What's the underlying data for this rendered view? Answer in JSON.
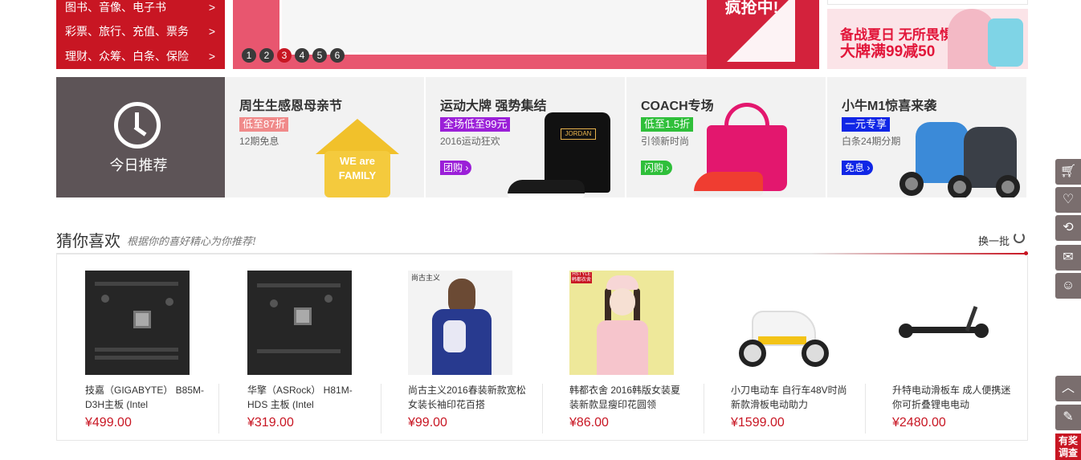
{
  "category_menu": {
    "items": [
      {
        "label": "图书、音像、电子书",
        "arrow": ">"
      },
      {
        "label": "彩票、旅行、充值、票务",
        "arrow": ">"
      },
      {
        "label": "理财、众筹、白条、保险",
        "arrow": ">"
      }
    ]
  },
  "banner": {
    "promo_text": "疯抢中!",
    "dots": [
      "1",
      "2",
      "3",
      "4",
      "5",
      "6"
    ],
    "active_dot": "3"
  },
  "right_ad": {
    "line1": "备战夏日 无所畏惧",
    "line2": "大牌满99减50"
  },
  "today": {
    "label": "今日推荐"
  },
  "recommendations": [
    {
      "title": "周生生感恩母亲节",
      "tag": "低至87折",
      "tag_color": "#f08a8a",
      "subtitle": "12期免息",
      "button": "",
      "image_text": "WE are FAMILY"
    },
    {
      "title": "运动大牌 强势集结",
      "tag": "全场低至99元",
      "tag_color": "#9b1fd8",
      "subtitle": "2016运动狂欢",
      "button": "团购 ›",
      "button_color": "#9b1fd8",
      "image_text": "JORDAN"
    },
    {
      "title": "COACH专场",
      "tag": "低至1.5折",
      "tag_color": "#2fbf3a",
      "subtitle": "引领新时尚",
      "button": "闪购 ›",
      "button_color": "#2fbf3a",
      "image_text": ""
    },
    {
      "title": "小牛M1惊喜来袭",
      "tag": "一元专享",
      "tag_color": "#1026e6",
      "subtitle": "白条24期分期",
      "button": "免息 ›",
      "button_color": "#1026e6",
      "image_text": ""
    }
  ],
  "guess": {
    "title": "猜你喜欢",
    "subtitle": "根据你的喜好精心为你推荐!",
    "refresh": "换一批",
    "products": [
      {
        "name": "技嘉（GIGABYTE） B85M-D3H主板 (Intel",
        "price": "¥499.00"
      },
      {
        "name": "华擎（ASRock） H81M-HDS 主板 (Intel",
        "price": "¥319.00"
      },
      {
        "name": "尚古主义2016春装新款宽松女装长袖印花百搭",
        "price": "¥99.00"
      },
      {
        "name": "韩都衣舍 2016韩版女装夏装新款显瘦印花圆领",
        "price": "¥86.00"
      },
      {
        "name": "小刀电动车 自行车48V时尚新款滑板电动助力",
        "price": "¥1599.00"
      },
      {
        "name": "升特电动滑板车 成人便携迷你可折叠锂电电动",
        "price": "¥2480.00"
      }
    ],
    "image_labels": {
      "fashion1": "尚古主义",
      "fashion2": "HSTYLE 韩都衣舍"
    }
  },
  "toolbar": {
    "icons": [
      "cart-icon",
      "heart-icon",
      "history-icon",
      "message-icon",
      "service-icon"
    ],
    "back_to_top": "︿",
    "feedback": "✎",
    "survey": "有奖调查"
  }
}
